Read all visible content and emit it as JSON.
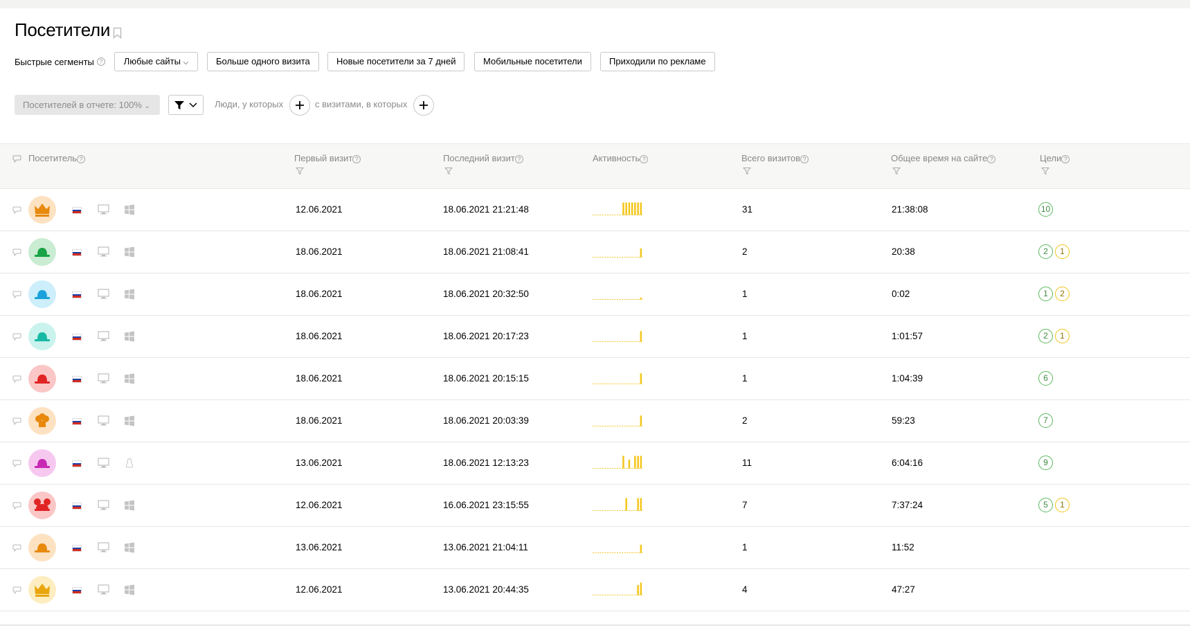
{
  "page": {
    "title": "Посетители"
  },
  "segments": {
    "label": "Быстрые сегменты",
    "help": "?",
    "buttons": [
      "Любые сайты",
      "Больше одного визита",
      "Новые посетители за 7 дней",
      "Мобильные посетители",
      "Приходили по рекламе"
    ]
  },
  "filters": {
    "share_button": "Посетителей в отчете: 100%",
    "people_label": "Люди, у которых",
    "visits_label": "с визитами, в которых"
  },
  "table": {
    "columns": {
      "visitor": "Посетитель",
      "first_visit": "Первый визит",
      "last_visit": "Последний визит",
      "activity": "Активность",
      "total_visits": "Всего визитов",
      "total_time": "Общее время на сайте",
      "goals": "Цели"
    },
    "rows": [
      {
        "avatar": "crown",
        "avatar_bg": "#fde2c2",
        "avatar_fg": "#e8890c",
        "os": "windows",
        "first": "12.06.2021",
        "last": "18.06.2021 21:21:48",
        "activity": [
          0,
          0,
          0,
          0,
          0,
          0,
          0,
          0,
          0,
          0,
          1,
          1,
          1,
          1,
          1,
          1,
          1
        ],
        "visits": "31",
        "time": "21:38:08",
        "goals": [
          {
            "n": "10",
            "c": "green"
          }
        ]
      },
      {
        "avatar": "hat",
        "avatar_bg": "#c9ecd2",
        "avatar_fg": "#18a347",
        "os": "windows",
        "first": "18.06.2021",
        "last": "18.06.2021 21:08:41",
        "activity": [
          0,
          0,
          0,
          0,
          0,
          0,
          0,
          0,
          0,
          0,
          0,
          0,
          0,
          0,
          0,
          0,
          0.7
        ],
        "visits": "2",
        "time": "20:38",
        "goals": [
          {
            "n": "2",
            "c": "green"
          },
          {
            "n": "1",
            "c": "yellow"
          }
        ]
      },
      {
        "avatar": "hat",
        "avatar_bg": "#cdeefb",
        "avatar_fg": "#1ba2db",
        "os": "windows",
        "first": "18.06.2021",
        "last": "18.06.2021 20:32:50",
        "activity": [
          0,
          0,
          0,
          0,
          0,
          0,
          0,
          0,
          0,
          0,
          0,
          0,
          0,
          0,
          0,
          0,
          0.15
        ],
        "visits": "1",
        "time": "0:02",
        "goals": [
          {
            "n": "1",
            "c": "green"
          },
          {
            "n": "2",
            "c": "yellow"
          }
        ]
      },
      {
        "avatar": "hat",
        "avatar_bg": "#c9f3ec",
        "avatar_fg": "#17b9a4",
        "os": "windows",
        "first": "18.06.2021",
        "last": "18.06.2021 20:17:23",
        "activity": [
          0,
          0,
          0,
          0,
          0,
          0,
          0,
          0,
          0,
          0,
          0,
          0,
          0,
          0,
          0,
          0,
          0.85
        ],
        "visits": "1",
        "time": "1:01:57",
        "goals": [
          {
            "n": "2",
            "c": "green"
          },
          {
            "n": "1",
            "c": "yellow"
          }
        ]
      },
      {
        "avatar": "hat",
        "avatar_bg": "#fbc6c6",
        "avatar_fg": "#e02424",
        "os": "windows",
        "first": "18.06.2021",
        "last": "18.06.2021 20:15:15",
        "activity": [
          0,
          0,
          0,
          0,
          0,
          0,
          0,
          0,
          0,
          0,
          0,
          0,
          0,
          0,
          0,
          0,
          0.85
        ],
        "visits": "1",
        "time": "1:04:39",
        "goals": [
          {
            "n": "6",
            "c": "green"
          }
        ]
      },
      {
        "avatar": "chef",
        "avatar_bg": "#fde2c2",
        "avatar_fg": "#e8890c",
        "os": "windows",
        "first": "18.06.2021",
        "last": "18.06.2021 20:03:39",
        "activity": [
          0,
          0,
          0,
          0,
          0,
          0,
          0,
          0,
          0,
          0,
          0,
          0,
          0,
          0,
          0,
          0,
          0.85
        ],
        "visits": "2",
        "time": "59:23",
        "goals": [
          {
            "n": "7",
            "c": "green"
          }
        ]
      },
      {
        "avatar": "hat",
        "avatar_bg": "#f6c8f0",
        "avatar_fg": "#c829b3",
        "os": "linux",
        "first": "13.06.2021",
        "last": "18.06.2021 12:13:23",
        "activity": [
          0,
          0,
          0,
          0,
          0,
          0,
          0,
          0,
          0,
          0,
          1,
          0,
          0.7,
          0,
          1,
          1,
          1
        ],
        "visits": "11",
        "time": "6:04:16",
        "goals": [
          {
            "n": "9",
            "c": "green"
          }
        ]
      },
      {
        "avatar": "mouse",
        "avatar_bg": "#fbc6c6",
        "avatar_fg": "#e02424",
        "os": "windows",
        "first": "12.06.2021",
        "last": "16.06.2021 23:15:55",
        "activity": [
          0,
          0,
          0,
          0,
          0,
          0,
          0,
          0,
          0,
          0,
          0,
          1,
          0,
          0,
          0,
          1,
          1
        ],
        "visits": "7",
        "time": "7:37:24",
        "goals": [
          {
            "n": "5",
            "c": "green"
          },
          {
            "n": "1",
            "c": "yellow"
          }
        ]
      },
      {
        "avatar": "hat",
        "avatar_bg": "#fde2c2",
        "avatar_fg": "#e8890c",
        "os": "windows",
        "first": "13.06.2021",
        "last": "13.06.2021 21:04:11",
        "activity": [
          0,
          0,
          0,
          0,
          0,
          0,
          0,
          0,
          0,
          0,
          0,
          0,
          0,
          0,
          0,
          0,
          0.65
        ],
        "visits": "1",
        "time": "11:52",
        "goals": []
      },
      {
        "avatar": "crown",
        "avatar_bg": "#fdedc0",
        "avatar_fg": "#e8a50c",
        "os": "windows",
        "first": "12.06.2021",
        "last": "13.06.2021 20:44:35",
        "activity": [
          0,
          0,
          0,
          0,
          0,
          0,
          0,
          0,
          0,
          0,
          0,
          0,
          0,
          0,
          0,
          0.8,
          1
        ],
        "visits": "4",
        "time": "47:27",
        "goals": []
      }
    ]
  }
}
